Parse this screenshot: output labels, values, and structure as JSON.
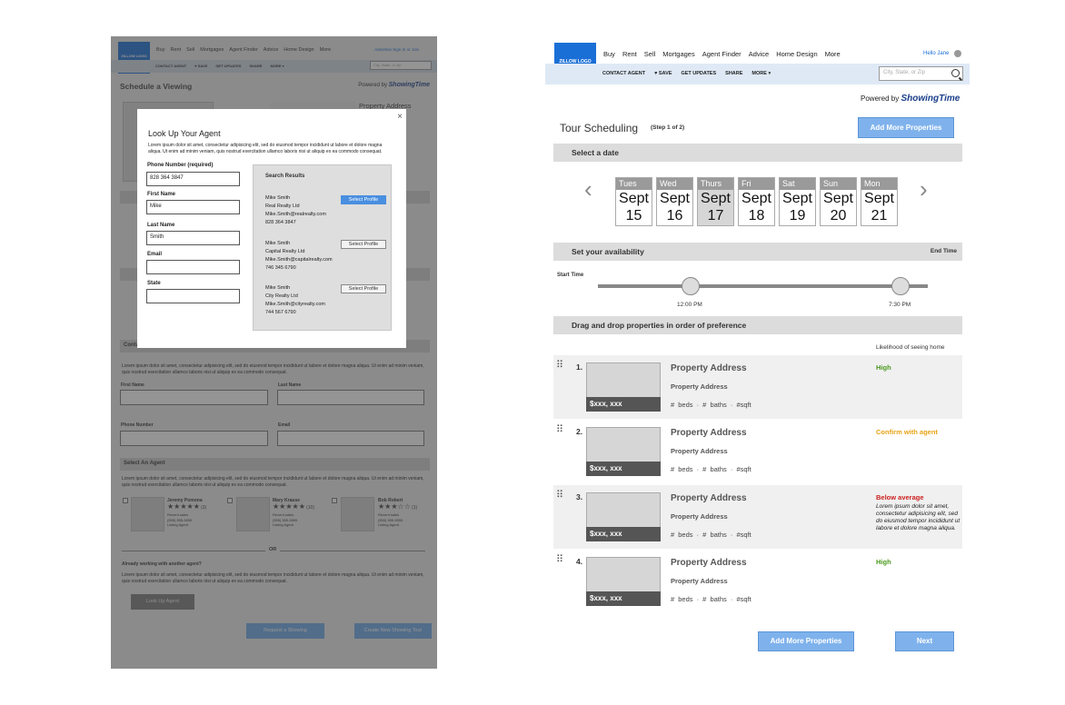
{
  "left": {
    "logo": "ZILLOW LOGO",
    "nav": [
      "Buy",
      "Rent",
      "Sell",
      "Mortgages",
      "Agent Finder",
      "Advice",
      "Home Design",
      "More"
    ],
    "util": "Advertise Sign In or Join",
    "subnav": [
      "CONTACT AGENT",
      "♥ SAVE",
      "GET UPDATES",
      "SHARE",
      "MORE ▾"
    ],
    "search_placeholder": "City, State, or Zip",
    "title": "Schedule a Viewing",
    "powered_by": "Powered by",
    "powered_brand": "ShowingTime",
    "property_address": "Property Address",
    "contact_section": "Contact Information",
    "contact_para": "Lorem ipsum dolor sit amet, consectetur adipisicing elit, sed do eiusmod tempor incididunt ut labore et dolore magna aliqua. Ut enim ad minim veniam, quis nostrud exercitation ullamco laboris nisi ut aliquip ex ea commodo consequat.",
    "first_name": "First Name",
    "last_name": "Last Name",
    "phone_number": "Phone Number",
    "email": "Email",
    "select_agent_section": "Select An Agent",
    "select_agent_para": "Lorem ipsum dolor sit amet, consectetur adipisicing elit, sed do eiusmod tempor incididunt ut labore et dolore magna aliqua. Ut enim ad minim veniam, quis nostrud exercitation ullamco laboris nisi ut aliquip ex ea commodo consequat.",
    "agents": [
      {
        "name": "Jeremy Pomona",
        "stars": "★★★★★",
        "count": "(3)",
        "meta": [
          "Recent sales",
          "(555) 555-5555",
          "Listing Agent"
        ]
      },
      {
        "name": "Mary Krause",
        "stars": "★★★★★",
        "count": "(10)",
        "meta": [
          "Recent sales",
          "(555) 555-5555",
          "Listing Agent"
        ]
      },
      {
        "name": "Bob Robert",
        "stars": "★★★☆☆",
        "count": "(1)",
        "meta": [
          "Recent sales",
          "(555) 555-5555",
          "Listing Agent"
        ]
      }
    ],
    "or": "OR",
    "already_working": "Already working with another agent?",
    "already_para": "Lorem ipsum dolor sit amet, consectetur adipisicing elit, sed do eiusmod tempor incididunt ut labore et dolore magna aliqua. Ut enim ad minim veniam, quis nostrud exercitation ullamco laboris nisi ut aliquip ex ea commodo consequat.",
    "look_up_agent": "Look Up Agent",
    "request_showing": "Request a Showing",
    "create_tour": "Create New Showing Tour"
  },
  "modal": {
    "close": "×",
    "title": "Look Up Your Agent",
    "para": "Lorem ipsum dolor sit amet, consectetur adipisicing elit, sed do eiusmod tempor incididunt ut labore et dolore magna aliqua. Ut enim ad minim veniam, quis nostrud exercitation ullamco laboris nisi ut aliquip ex ea commodo consequat.",
    "phone_label": "Phone Number (required)",
    "phone_value": "828 364 3847",
    "first_label": "First Name",
    "first_value": "Mike",
    "last_label": "Last Name",
    "last_value": "Smith",
    "email_label": "Email",
    "state_label": "State",
    "results_title": "Search Results",
    "select_label": "Select  Profile",
    "results": [
      {
        "name": "Mike Smith",
        "company": "Real Realty Ltd",
        "email": "Mike.Smith@realrealty.com",
        "phone": "828 364 3847"
      },
      {
        "name": "Mike Smith",
        "company": "Capital Realty Ltd",
        "email": "Mike.Smith@capitalrealty.com",
        "phone": "746 345 6790"
      },
      {
        "name": "Mike Smith",
        "company": "City Realty Ltd",
        "email": "Mike.Smith@cityrealty.com",
        "phone": "744 567 6790"
      }
    ]
  },
  "right": {
    "logo": "ZILLOW LOGO",
    "nav": [
      "Buy",
      "Rent",
      "Sell",
      "Mortgages",
      "Agent Finder",
      "Advice",
      "Home Design",
      "More"
    ],
    "hello": "Hello Jane",
    "subnav": [
      "CONTACT AGENT",
      "♥ SAVE",
      "GET UPDATES",
      "SHARE",
      "MORE ▾"
    ],
    "search_placeholder": "City, State, or Zip",
    "powered_by": "Powered by",
    "powered_brand": "ShowingTime",
    "title": "Tour Scheduling",
    "step": "(Step 1 of 2)",
    "add_more": "Add More Properties",
    "select_date": "Select a date",
    "prev": "‹",
    "next_arrow": "›",
    "days": [
      {
        "name": "Tues",
        "month": "Sept",
        "num": "15"
      },
      {
        "name": "Wed",
        "month": "Sept",
        "num": "16"
      },
      {
        "name": "Thurs",
        "month": "Sept",
        "num": "17"
      },
      {
        "name": "Fri",
        "month": "Sept",
        "num": "18"
      },
      {
        "name": "Sat",
        "month": "Sept",
        "num": "19"
      },
      {
        "name": "Sun",
        "month": "Sept",
        "num": "20"
      },
      {
        "name": "Mon",
        "month": "Sept",
        "num": "21"
      }
    ],
    "availability": "Set your availability",
    "end_time": "End Time",
    "start_time": "Start Time",
    "time_start": "12:00 PM",
    "time_end": "7:30 PM",
    "drag_section": "Drag and drop properties in order of preference",
    "likelihood": "Likelihood of seeing home",
    "properties": [
      {
        "num": "1.",
        "price": "$xxx, xxx",
        "address": "Property Address",
        "address2": "Property Address",
        "meta": "# beds  ·  # baths  ·  #sqft",
        "status": "High",
        "status_color": "#4a9a1e",
        "note": ""
      },
      {
        "num": "2.",
        "price": "$xxx, xxx",
        "address": "Property Address",
        "address2": "Property Address",
        "meta": "# beds  ·  # baths  ·  #sqft",
        "status": "Confirm with agent",
        "status_color": "#e8a317",
        "note": ""
      },
      {
        "num": "3.",
        "price": "$xxx, xxx",
        "address": "Property Address",
        "address2": "Property Address",
        "meta": "# beds  ·  # baths  ·  #sqft",
        "status": "Below average",
        "status_color": "#cc1f1f",
        "note": "Lorem ipsum dolor sit amet, consectetur adipisicing elit, sed do eiusmod tempor incididunt ut labore et dolore magna aliqua."
      },
      {
        "num": "4.",
        "price": "$xxx, xxx",
        "address": "Property Address",
        "address2": "Property Address",
        "meta": "# beds  ·  # baths  ·  #sqft",
        "status": "High",
        "status_color": "#4a9a1e",
        "note": ""
      }
    ],
    "add_more_bottom": "Add More Properties",
    "next": "Next"
  }
}
